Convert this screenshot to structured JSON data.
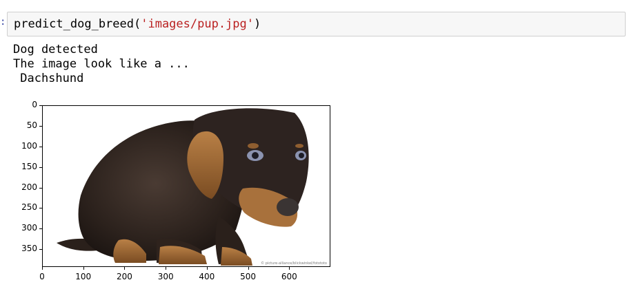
{
  "cell": {
    "prompt_marker": ":",
    "code": {
      "function": "predict_dog_breed(",
      "argument": "'images/pup.jpg'",
      "close": ")"
    }
  },
  "output": {
    "lines": [
      "Dog detected",
      "The image look like a ...",
      " Dachshund"
    ]
  },
  "figure": {
    "image_subject": "dachshund puppy photo",
    "credit": "© picture-alliance/blickwinkel/fotototo",
    "y_ticks": [
      "0",
      "50",
      "100",
      "150",
      "200",
      "250",
      "300",
      "350"
    ],
    "x_ticks": [
      "0",
      "100",
      "200",
      "300",
      "400",
      "500",
      "600"
    ],
    "x_range": [
      0,
      700
    ],
    "y_range": [
      0,
      393
    ]
  }
}
